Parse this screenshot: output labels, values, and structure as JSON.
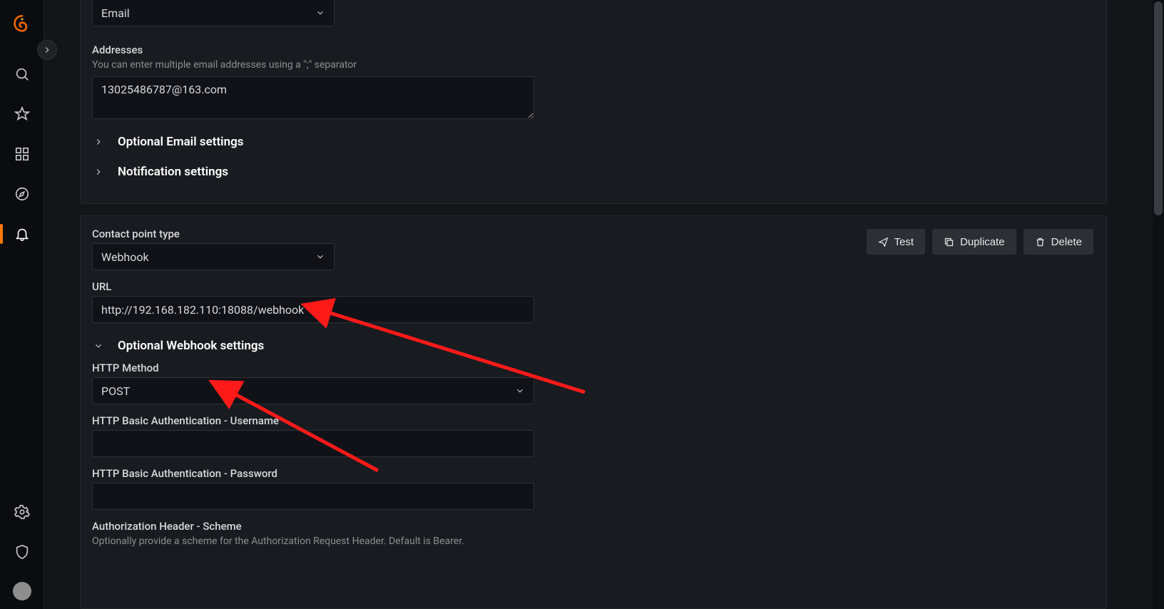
{
  "sidebar": {
    "items": [
      {
        "name": "search-icon"
      },
      {
        "name": "star-icon"
      },
      {
        "name": "apps-icon"
      },
      {
        "name": "compass-icon"
      },
      {
        "name": "bell-icon"
      }
    ],
    "bottom": [
      {
        "name": "gear-icon"
      },
      {
        "name": "shield-icon"
      }
    ]
  },
  "email_panel": {
    "type_value": "Email",
    "addresses_label": "Addresses",
    "addresses_hint": "You can enter multiple email addresses using a \";\" separator",
    "addresses_value": "13025486787@163.com",
    "optional_header": "Optional Email settings",
    "notification_header": "Notification settings"
  },
  "actions": {
    "test": "Test",
    "duplicate": "Duplicate",
    "delete": "Delete"
  },
  "webhook_panel": {
    "type_label": "Contact point type",
    "type_value": "Webhook",
    "url_label": "URL",
    "url_value": "http://192.168.182.110:18088/webhook",
    "optional_header": "Optional Webhook settings",
    "http_method_label": "HTTP Method",
    "http_method_value": "POST",
    "basic_user_label": "HTTP Basic Authentication - Username",
    "basic_user_value": "",
    "basic_pass_label": "HTTP Basic Authentication - Password",
    "basic_pass_value": "",
    "auth_scheme_label": "Authorization Header - Scheme",
    "auth_scheme_hint": "Optionally provide a scheme for the Authorization Request Header. Default is Bearer."
  }
}
